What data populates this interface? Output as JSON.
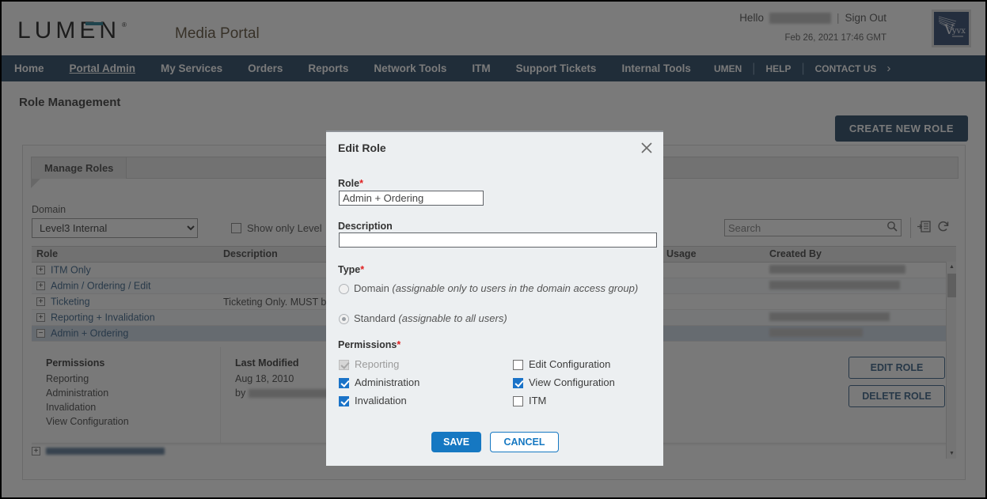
{
  "header": {
    "logo_text": "LUMEN",
    "logo_registered": "®",
    "portal_title": "Media Portal",
    "hello_label": "Hello",
    "hello_user_redacted": "Matthew",
    "separator": "|",
    "sign_out": "Sign Out",
    "timestamp": "Feb 26, 2021 17:46 GMT",
    "brand_logo_alt": "Vyvx",
    "accent_color": "#0a6e86",
    "nav_bg_color": "#0b2e4f"
  },
  "nav": {
    "items": [
      {
        "label": "Home",
        "active": false
      },
      {
        "label": "Portal Admin",
        "active": true
      },
      {
        "label": "My Services",
        "active": false
      },
      {
        "label": "Orders",
        "active": false
      },
      {
        "label": "Reports",
        "active": false
      },
      {
        "label": "Network Tools",
        "active": false
      },
      {
        "label": "ITM",
        "active": false
      },
      {
        "label": "Support Tickets",
        "active": false
      },
      {
        "label": "Internal Tools",
        "active": false
      }
    ],
    "right_items": [
      {
        "label": "UMEN"
      },
      {
        "label": "HELP"
      },
      {
        "label": "CONTACT US"
      }
    ],
    "arrow_glyph": "›"
  },
  "page": {
    "title": "Role Management",
    "create_button": "CREATE NEW ROLE",
    "panel_tab": "Manage Roles"
  },
  "filters": {
    "domain_label": "Domain",
    "domain_value": "Level3 Internal",
    "domain_options": [
      "Level3 Internal"
    ],
    "show_only_label": "Show only Level",
    "show_only_checked": false,
    "search_placeholder": "Search",
    "search_value": "",
    "search_icon": "search-icon",
    "export_icon": "export-icon",
    "refresh_icon": "refresh-icon"
  },
  "table": {
    "columns": [
      "Role",
      "Description",
      "Usage",
      "Created By"
    ],
    "rows": [
      {
        "expander": "+",
        "role": "ITM Only",
        "description": "",
        "usage": "",
        "created_by_redacted": "andrew.shaw@level3.com",
        "selected": false
      },
      {
        "expander": "+",
        "role": "Admin / Ordering / Edit",
        "description": "",
        "usage": "",
        "created_by_redacted": "shane.rocha@level3.com",
        "selected": false
      },
      {
        "expander": "+",
        "role": "Ticketing",
        "description": "Ticketing Only. MUST b",
        "usage": "",
        "created_by_redacted": "",
        "selected": false
      },
      {
        "expander": "+",
        "role": "Reporting + Invalidation",
        "description": "",
        "usage": "",
        "created_by_redacted": "amy.bethke@level3.com",
        "selected": false
      },
      {
        "expander": "−",
        "role": "Admin + Ordering",
        "description": "",
        "usage": "",
        "created_by_redacted": "jan.long@level3.com",
        "selected": true
      }
    ],
    "detail": {
      "permissions_header": "Permissions",
      "permissions": [
        "Reporting",
        "Administration",
        "Invalidation",
        "View Configuration"
      ],
      "last_modified_header": "Last Modified",
      "last_modified_date": "Aug 18, 2010",
      "last_modified_by_prefix": "by",
      "last_modified_by_redacted": "jan.long@level3.com",
      "edit_button": "EDIT ROLE",
      "delete_button": "DELETE ROLE"
    },
    "next_row_role_redacted": "ITSP / Edit"
  },
  "modal": {
    "title": "Edit Role",
    "close_icon": "close-icon",
    "role_label": "Role",
    "role_required": "*",
    "role_value": "Admin + Ordering",
    "description_label": "Description",
    "description_value": "",
    "type_label": "Type",
    "type_required": "*",
    "type_options": [
      {
        "label": "Domain",
        "hint": "(assignable only to users in the domain access group)",
        "selected": false
      },
      {
        "label": "Standard",
        "hint": "(assignable to all users)",
        "selected": true
      }
    ],
    "permissions_label": "Permissions",
    "permissions_required": "*",
    "permissions_left": [
      {
        "label": "Reporting",
        "checked": true,
        "disabled": true
      },
      {
        "label": "Administration",
        "checked": true,
        "disabled": false
      },
      {
        "label": "Invalidation",
        "checked": true,
        "disabled": false
      }
    ],
    "permissions_right": [
      {
        "label": "Edit Configuration",
        "checked": false,
        "disabled": false
      },
      {
        "label": "View Configuration",
        "checked": true,
        "disabled": false
      },
      {
        "label": "ITM",
        "checked": false,
        "disabled": false
      }
    ],
    "save_button": "SAVE",
    "cancel_button": "CANCEL",
    "save_color": "#1678c2"
  }
}
